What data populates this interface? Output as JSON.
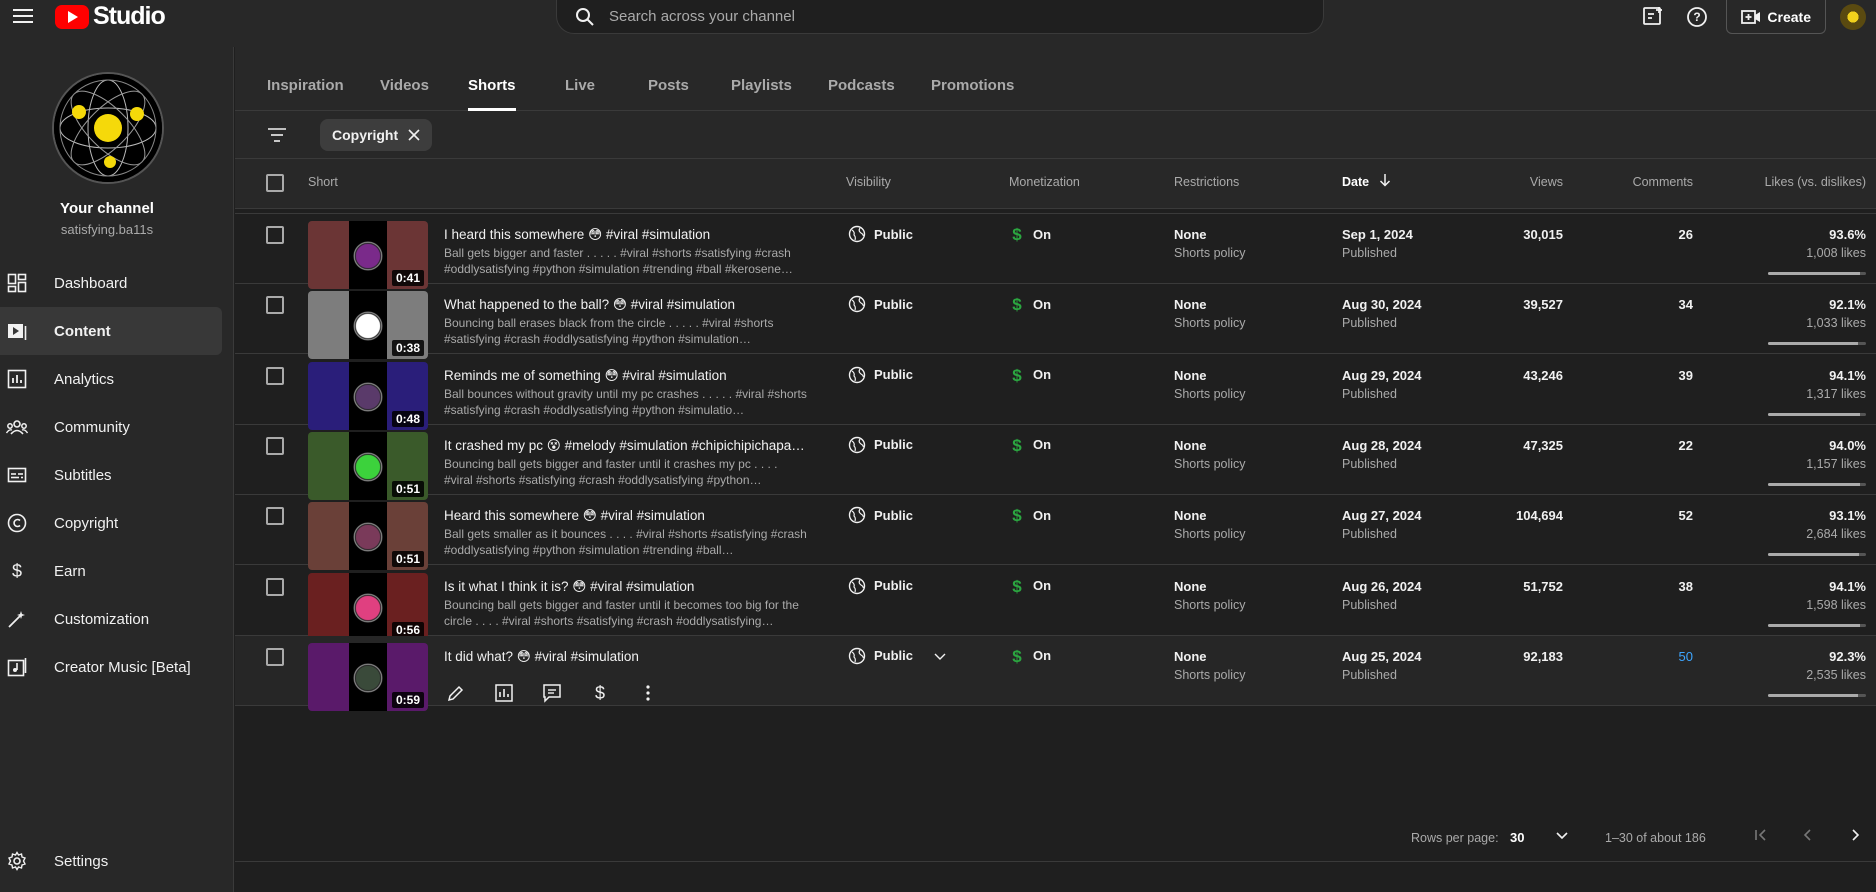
{
  "app": {
    "logo_text": "Studio",
    "search_placeholder": "Search across your channel",
    "create_label": "Create"
  },
  "channel": {
    "title": "Your channel",
    "handle": "satisfying.ba11s"
  },
  "sidebar": {
    "items": [
      {
        "label": "Dashboard",
        "icon": "dashboard-icon"
      },
      {
        "label": "Content",
        "icon": "content-icon",
        "active": true
      },
      {
        "label": "Analytics",
        "icon": "analytics-icon"
      },
      {
        "label": "Community",
        "icon": "community-icon"
      },
      {
        "label": "Subtitles",
        "icon": "subtitles-icon"
      },
      {
        "label": "Copyright",
        "icon": "copyright-icon"
      },
      {
        "label": "Earn",
        "icon": "earn-icon"
      },
      {
        "label": "Customization",
        "icon": "customization-icon"
      },
      {
        "label": "Creator Music [Beta]",
        "icon": "music-icon"
      }
    ],
    "settings_label": "Settings"
  },
  "tabs": [
    "Inspiration",
    "Videos",
    "Shorts",
    "Live",
    "Posts",
    "Playlists",
    "Podcasts",
    "Promotions"
  ],
  "active_tab": "Shorts",
  "filter_chip": "Copyright",
  "columns": {
    "short": "Short",
    "visibility": "Visibility",
    "monetization": "Monetization",
    "restrictions": "Restrictions",
    "date": "Date",
    "views": "Views",
    "comments": "Comments",
    "likes": "Likes (vs. dislikes)"
  },
  "rows": [
    {
      "title": "I heard this somewhere 😳 #viral #simulation",
      "desc": "Ball gets bigger and faster . . . . . #viral #shorts #satisfying #crash #oddlysatisfying #python #simulation #trending #ball #kerosene…",
      "duration": "0:41",
      "visibility": "Public",
      "monetization": "On",
      "restriction": "None",
      "restriction_sub": "Shorts policy",
      "date": "Sep 1, 2024",
      "date_sub": "Published",
      "views": "30,015",
      "comments": "26",
      "pct": "93.6%",
      "likes": "1,008 likes",
      "ratio": 0.936,
      "bg": "#6b3535",
      "ball": "#7a2a8a"
    },
    {
      "title": "What happened to the ball? 😳 #viral #simulation",
      "desc": "Bouncing ball erases black from the circle . . . . . #viral #shorts #satisfying #crash #oddlysatisfying #python #simulation…",
      "duration": "0:38",
      "visibility": "Public",
      "monetization": "On",
      "restriction": "None",
      "restriction_sub": "Shorts policy",
      "date": "Aug 30, 2024",
      "date_sub": "Published",
      "views": "39,527",
      "comments": "34",
      "pct": "92.1%",
      "likes": "1,033 likes",
      "ratio": 0.921,
      "bg": "#7d7d7d",
      "ball": "#ffffff"
    },
    {
      "title": "Reminds me of something 😳 #viral #simulation",
      "desc": "Ball bounces without gravity until my pc crashes . . . . . #viral #shorts #satisfying #crash #oddlysatisfying #python #simulatio…",
      "duration": "0:48",
      "visibility": "Public",
      "monetization": "On",
      "restriction": "None",
      "restriction_sub": "Shorts policy",
      "date": "Aug 29, 2024",
      "date_sub": "Published",
      "views": "43,246",
      "comments": "39",
      "pct": "94.1%",
      "likes": "1,317 likes",
      "ratio": 0.941,
      "bg": "#2a1e7a",
      "ball": "#5a3a6a"
    },
    {
      "title": "It crashed my pc 😵 #melody #simulation #chipichipichapac…",
      "desc": "Bouncing ball gets bigger and faster until it crashes my pc . . . . #viral #shorts #satisfying #crash #oddlysatisfying #python…",
      "duration": "0:51",
      "visibility": "Public",
      "monetization": "On",
      "restriction": "None",
      "restriction_sub": "Shorts policy",
      "date": "Aug 28, 2024",
      "date_sub": "Published",
      "views": "47,325",
      "comments": "22",
      "pct": "94.0%",
      "likes": "1,157 likes",
      "ratio": 0.94,
      "bg": "#3a5a2a",
      "ball": "#3cd23c"
    },
    {
      "title": "Heard this somewhere 😳 #viral #simulation",
      "desc": "Ball gets smaller as it bounces . . . . #viral #shorts #satisfying #crash #oddlysatisfying #python #simulation #trending #ball…",
      "duration": "0:51",
      "visibility": "Public",
      "monetization": "On",
      "restriction": "None",
      "restriction_sub": "Shorts policy",
      "date": "Aug 27, 2024",
      "date_sub": "Published",
      "views": "104,694",
      "comments": "52",
      "pct": "93.1%",
      "likes": "2,684 likes",
      "ratio": 0.931,
      "bg": "#6a4038",
      "ball": "#7a3a5a"
    },
    {
      "title": "Is it what I think it is? 😳 #viral #simulation",
      "desc": "Bouncing ball gets bigger and faster until it becomes too big for the circle . . . . #viral #shorts #satisfying #crash #oddlysatisfying…",
      "duration": "0:56",
      "visibility": "Public",
      "monetization": "On",
      "restriction": "None",
      "restriction_sub": "Shorts policy",
      "date": "Aug 26, 2024",
      "date_sub": "Published",
      "views": "51,752",
      "comments": "38",
      "pct": "94.1%",
      "likes": "1,598 likes",
      "ratio": 0.941,
      "bg": "#6a2020",
      "ball": "#e04080"
    },
    {
      "title": "It did what? 😳 #viral #simulation",
      "desc": "",
      "duration": "0:59",
      "visibility": "Public",
      "monetization": "On",
      "restriction": "None",
      "restriction_sub": "Shorts policy",
      "date": "Aug 25, 2024",
      "date_sub": "Published",
      "views": "92,183",
      "comments": "50",
      "pct": "92.3%",
      "likes": "2,535 likes",
      "ratio": 0.923,
      "bg": "#5a1a6a",
      "ball": "#3a4a3a"
    }
  ],
  "footer": {
    "rows_per_page_label": "Rows per page:",
    "rows_per_page_value": "30",
    "range": "1–30 of about 186"
  },
  "colors": {
    "accent_link": "#3ea6ff",
    "monetization_green": "#2ba640",
    "brand_red": "#ff0000"
  }
}
